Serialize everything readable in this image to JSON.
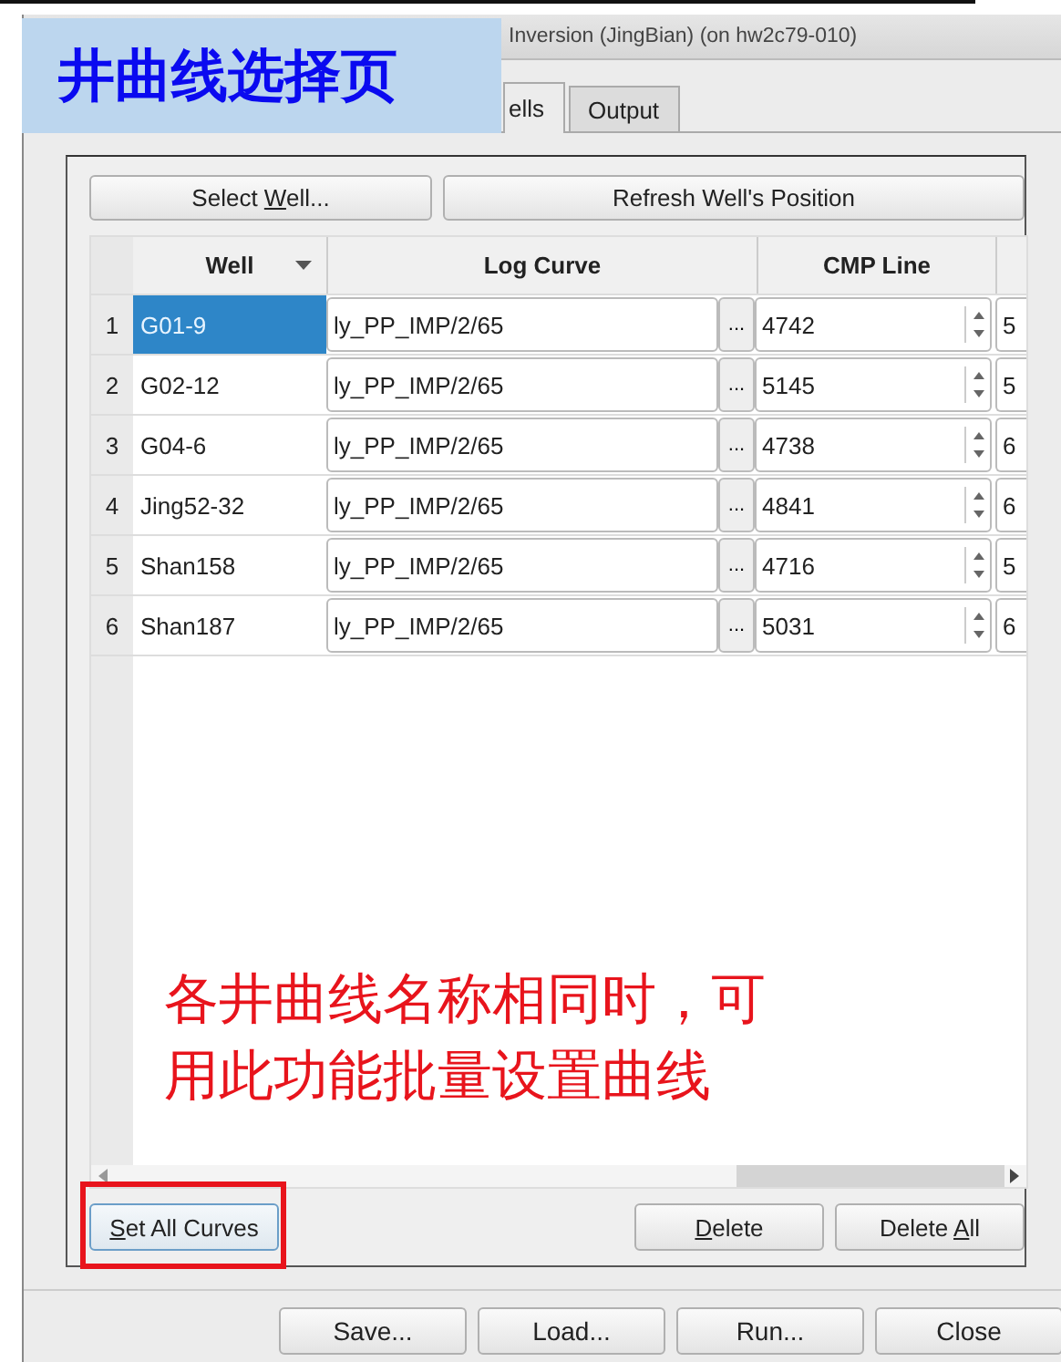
{
  "window": {
    "title": "Inversion (JingBian) (on hw2c79-010)"
  },
  "overlay_label": "井曲线选择页",
  "tabs": [
    {
      "label": "ells",
      "selected": true
    },
    {
      "label": "Output",
      "selected": false
    }
  ],
  "top_buttons": [
    {
      "pre": "Select ",
      "key": "W",
      "post": "ell..."
    },
    {
      "pre": "Refresh Well's Position"
    }
  ],
  "table": {
    "columns": [
      {
        "label": "Well",
        "sort": true
      },
      {
        "label": "Log Curve",
        "sort": false
      },
      {
        "label": "CMP Line",
        "sort": false
      }
    ],
    "rows": [
      {
        "num": "1",
        "well": "G01-9",
        "curve": "ly_PP_IMP/2/65",
        "cmp": "4742",
        "col4": "5",
        "selected": true
      },
      {
        "num": "2",
        "well": "G02-12",
        "curve": "ly_PP_IMP/2/65",
        "cmp": "5145",
        "col4": "5",
        "selected": false
      },
      {
        "num": "3",
        "well": "G04-6",
        "curve": "ly_PP_IMP/2/65",
        "cmp": "4738",
        "col4": "6",
        "selected": false
      },
      {
        "num": "4",
        "well": "Jing52-32",
        "curve": "ly_PP_IMP/2/65",
        "cmp": "4841",
        "col4": "6",
        "selected": false
      },
      {
        "num": "5",
        "well": "Shan158",
        "curve": "ly_PP_IMP/2/65",
        "cmp": "4716",
        "col4": "5",
        "selected": false
      },
      {
        "num": "6",
        "well": "Shan187",
        "curve": "ly_PP_IMP/2/65",
        "cmp": "5031",
        "col4": "6",
        "selected": false
      }
    ],
    "browse_label": "..."
  },
  "annotation": "各井曲线名称相同时，可用此功能批量设置曲线",
  "panel_buttons": [
    {
      "key": "S",
      "post": "et All Curves",
      "highlighted": true
    },
    {
      "key": "D",
      "post": "elete",
      "highlighted": false
    },
    {
      "pre": "Delete ",
      "key": "A",
      "post": "ll",
      "highlighted": false
    }
  ],
  "footer_buttons": [
    "Save...",
    "Load...",
    "Run...",
    "Close"
  ]
}
